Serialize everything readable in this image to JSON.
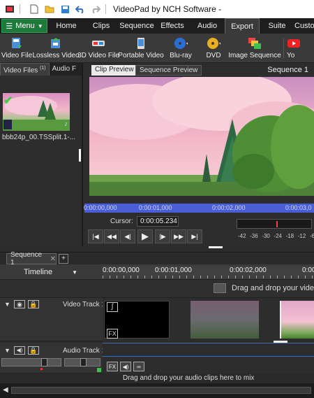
{
  "window": {
    "title": "VideoPad by NCH Software -"
  },
  "menu": {
    "menu_label": "Menu",
    "tabs": [
      "Home",
      "Clips",
      "Sequence",
      "Effects",
      "Audio",
      "Export",
      "Suite",
      "Custo"
    ],
    "active_tab": "Export"
  },
  "toolbar": {
    "buttons": [
      "Video File",
      "Lossless Video",
      "3D Video File",
      "Portable Video",
      "Blu-ray",
      "DVD",
      "Image Sequence",
      "Yo"
    ]
  },
  "bin": {
    "tabs": [
      "Video Files",
      "Audio F"
    ],
    "tab_badge": "(1)",
    "clip_name": "bbb24p_00.TSSplit.1-..."
  },
  "preview": {
    "tabs": [
      "Clip Preview",
      "Sequence Preview"
    ],
    "sequence_label": "Sequence 1",
    "ruler_times": [
      "0:00:00,000",
      "0:00:01,000",
      "0:00:02,000",
      "0:00:03,0"
    ],
    "cursor_label": "Cursor:",
    "cursor_value": "0:00:05.234",
    "meter_ticks": [
      "-42",
      "-36",
      "-30",
      "-24",
      "-18",
      "-12",
      "-6"
    ]
  },
  "timeline": {
    "sequence_tab": "Sequence 1",
    "add_tab": "+",
    "timeline_label": "Timeline",
    "ruler_times": [
      "0:00:00,000",
      "0:00:01,000",
      "0:00:02,000",
      "0:00:03"
    ],
    "drop_video_text": "Drag and drop your video",
    "video_track_label": "Video Track 1",
    "audio_track_label": "Audio Track 1",
    "drop_audio_text": "Drag and drop your audio clips here to mix"
  }
}
